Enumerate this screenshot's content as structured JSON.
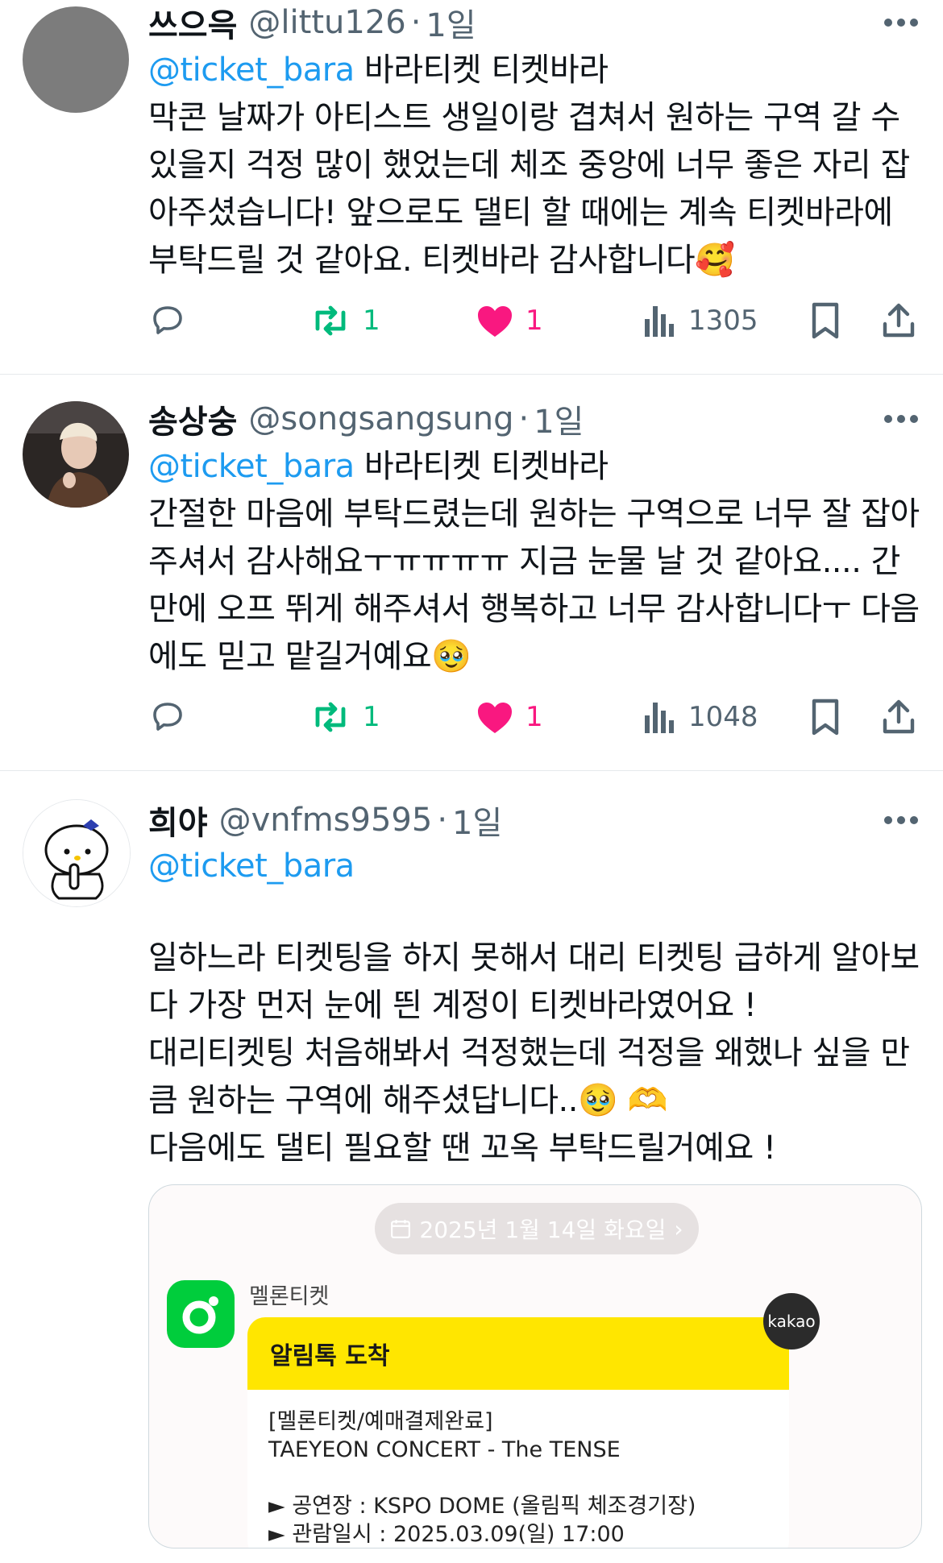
{
  "tweets": [
    {
      "name": "쓰으윽",
      "handle": "@littu126",
      "time": "1일",
      "mention": "@ticket_bara",
      "text": " 바라티켓 티켓바라\n막콘 날짜가 아티스트 생일이랑 겹쳐서 원하는 구역 갈 수 있을지 걱정 많이 했었는데 체조 중앙에 너무 좋은 자리 잡아주셨습니다! 앞으로도 댈티 할 때에는 계속 티켓바라에 부탁드릴 것 같아요. 티켓바라 감사합니다🥰",
      "retweets": "1",
      "likes": "1",
      "views": "1305"
    },
    {
      "name": "송상숭",
      "handle": "@songsangsung",
      "time": "1일",
      "mention": "@ticket_bara",
      "text": " 바라티켓 티켓바라\n간절한 마음에 부탁드렸는데 원하는 구역으로 너무 잘 잡아주셔서 감사해요ㅜㅠㅠㅠㅠ 지금 눈물 날 것 같아요.... 간만에 오프 뛰게 해주셔서 행복하고 너무 감사합니다ㅜ 다음에도 믿고 맡길거예요🥹",
      "retweets": "1",
      "likes": "1",
      "views": "1048"
    },
    {
      "name": "희야",
      "handle": "@vnfms9595",
      "time": "1일",
      "mention": "@ticket_bara",
      "text": "일하느라 티켓팅을 하지 못해서 대리 티켓팅 급하게 알아보다 가장 먼저 눈에 띈 계정이 티켓바라였어요 !\n대리티켓팅 처음해봐서 걱정했는데 걱정을 왜했나 싶을 만큼 원하는 구역에 해주셨답니다..🥹 🫶\n다음에도 댈티 필요할 땐 꼬옥 부탁드릴거예요 !"
    }
  ],
  "attachment": {
    "date": "2025년 1월 14일 화요일",
    "sender": "멜론티켓",
    "bubble_title": "알림톡 도착",
    "bubble_text": "[멜론티켓/예매결제완료]\nTAEYEON CONCERT - The TENSE\n\n► 공연장 : KSPO DOME (올림픽 체조경기장)\n► 관람일시 : 2025.03.09(일) 17:00",
    "badge": "kakao"
  },
  "colors": {
    "mention": "#1d9bf0",
    "retweet": "#00ba7c",
    "like": "#f91880",
    "secondary": "#536471"
  }
}
